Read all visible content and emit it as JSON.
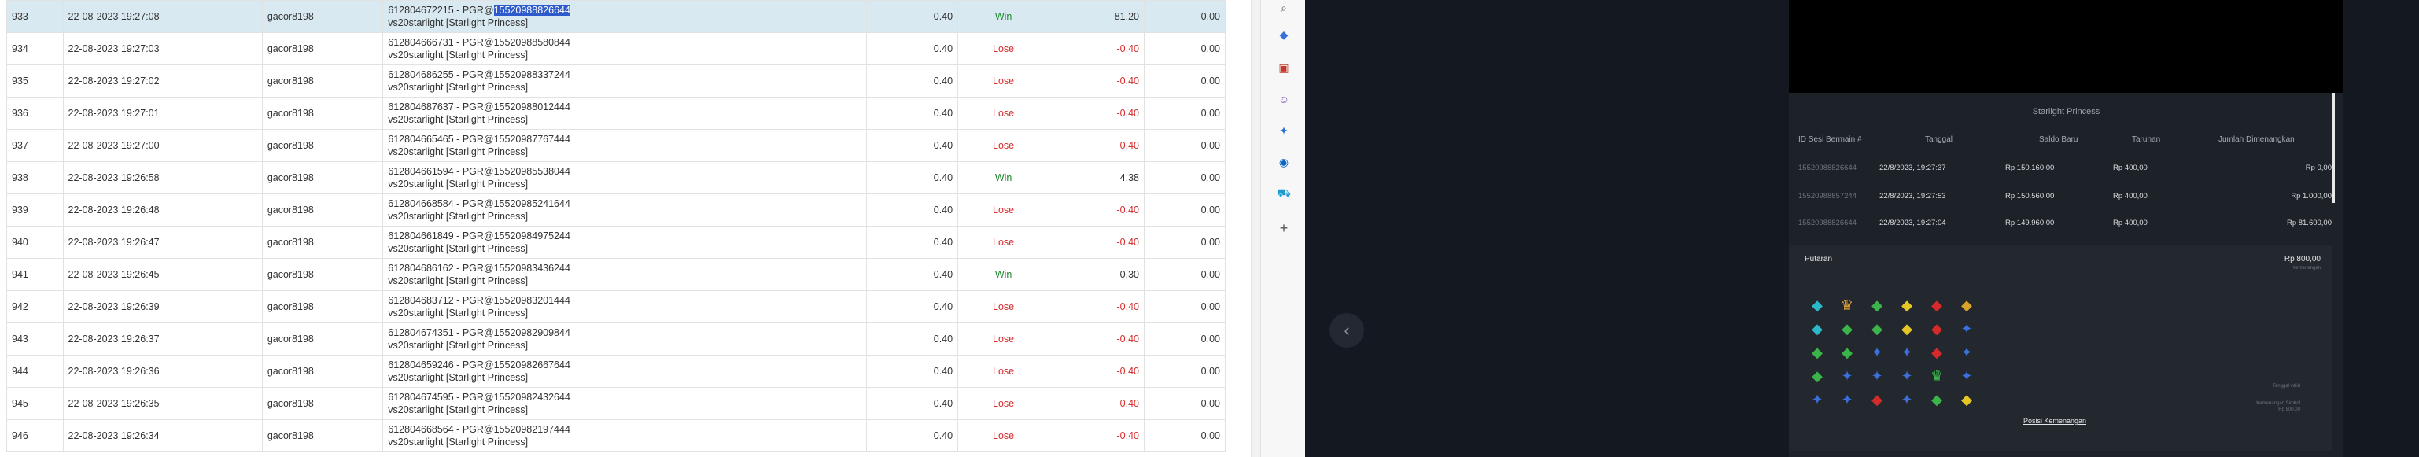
{
  "rows": [
    {
      "no": "933",
      "datetime": "22-08-2023 19:27:08",
      "user": "gacor8198",
      "desc_line1_pre": "612804672215 - PGR@",
      "desc_line1_hl": "15520988826644",
      "desc_line2": "vs20starlight [Starlight Princess]",
      "bet": "0.40",
      "result": "Win",
      "amount": "81.20",
      "extra": "0.00",
      "selected": true
    },
    {
      "no": "934",
      "datetime": "22-08-2023 19:27:03",
      "user": "gacor8198",
      "desc_line1_pre": "612804666731 - PGR@15520988580844",
      "desc_line1_hl": "",
      "desc_line2": "vs20starlight [Starlight Princess]",
      "bet": "0.40",
      "result": "Lose",
      "amount": "-0.40",
      "extra": "0.00"
    },
    {
      "no": "935",
      "datetime": "22-08-2023 19:27:02",
      "user": "gacor8198",
      "desc_line1_pre": "612804686255 - PGR@15520988337244",
      "desc_line1_hl": "",
      "desc_line2": "vs20starlight [Starlight Princess]",
      "bet": "0.40",
      "result": "Lose",
      "amount": "-0.40",
      "extra": "0.00"
    },
    {
      "no": "936",
      "datetime": "22-08-2023 19:27:01",
      "user": "gacor8198",
      "desc_line1_pre": "612804687637 - PGR@15520988012444",
      "desc_line1_hl": "",
      "desc_line2": "vs20starlight [Starlight Princess]",
      "bet": "0.40",
      "result": "Lose",
      "amount": "-0.40",
      "extra": "0.00"
    },
    {
      "no": "937",
      "datetime": "22-08-2023 19:27:00",
      "user": "gacor8198",
      "desc_line1_pre": "612804665465 - PGR@15520987767444",
      "desc_line1_hl": "",
      "desc_line2": "vs20starlight [Starlight Princess]",
      "bet": "0.40",
      "result": "Lose",
      "amount": "-0.40",
      "extra": "0.00"
    },
    {
      "no": "938",
      "datetime": "22-08-2023 19:26:58",
      "user": "gacor8198",
      "desc_line1_pre": "612804661594 - PGR@15520985538044",
      "desc_line1_hl": "",
      "desc_line2": "vs20starlight [Starlight Princess]",
      "bet": "0.40",
      "result": "Win",
      "amount": "4.38",
      "extra": "0.00"
    },
    {
      "no": "939",
      "datetime": "22-08-2023 19:26:48",
      "user": "gacor8198",
      "desc_line1_pre": "612804668584 - PGR@15520985241644",
      "desc_line1_hl": "",
      "desc_line2": "vs20starlight [Starlight Princess]",
      "bet": "0.40",
      "result": "Lose",
      "amount": "-0.40",
      "extra": "0.00"
    },
    {
      "no": "940",
      "datetime": "22-08-2023 19:26:47",
      "user": "gacor8198",
      "desc_line1_pre": "612804661849 - PGR@15520984975244",
      "desc_line1_hl": "",
      "desc_line2": "vs20starlight [Starlight Princess]",
      "bet": "0.40",
      "result": "Lose",
      "amount": "-0.40",
      "extra": "0.00"
    },
    {
      "no": "941",
      "datetime": "22-08-2023 19:26:45",
      "user": "gacor8198",
      "desc_line1_pre": "612804686162 - PGR@15520983436244",
      "desc_line1_hl": "",
      "desc_line2": "vs20starlight [Starlight Princess]",
      "bet": "0.40",
      "result": "Win",
      "amount": "0.30",
      "extra": "0.00"
    },
    {
      "no": "942",
      "datetime": "22-08-2023 19:26:39",
      "user": "gacor8198",
      "desc_line1_pre": "612804683712 - PGR@15520983201444",
      "desc_line1_hl": "",
      "desc_line2": "vs20starlight [Starlight Princess]",
      "bet": "0.40",
      "result": "Lose",
      "amount": "-0.40",
      "extra": "0.00"
    },
    {
      "no": "943",
      "datetime": "22-08-2023 19:26:37",
      "user": "gacor8198",
      "desc_line1_pre": "612804674351 - PGR@15520982909844",
      "desc_line1_hl": "",
      "desc_line2": "vs20starlight [Starlight Princess]",
      "bet": "0.40",
      "result": "Lose",
      "amount": "-0.40",
      "extra": "0.00"
    },
    {
      "no": "944",
      "datetime": "22-08-2023 19:26:36",
      "user": "gacor8198",
      "desc_line1_pre": "612804659246 - PGR@15520982667644",
      "desc_line1_hl": "",
      "desc_line2": "vs20starlight [Starlight Princess]",
      "bet": "0.40",
      "result": "Lose",
      "amount": "-0.40",
      "extra": "0.00"
    },
    {
      "no": "945",
      "datetime": "22-08-2023 19:26:35",
      "user": "gacor8198",
      "desc_line1_pre": "612804674595 - PGR@15520982432644",
      "desc_line1_hl": "",
      "desc_line2": "vs20starlight [Starlight Princess]",
      "bet": "0.40",
      "result": "Lose",
      "amount": "-0.40",
      "extra": "0.00"
    },
    {
      "no": "946",
      "datetime": "22-08-2023 19:26:34",
      "user": "gacor8198",
      "desc_line1_pre": "612804668564 - PGR@15520982197444",
      "desc_line1_hl": "",
      "desc_line2": "vs20starlight [Starlight Princess]",
      "bet": "0.40",
      "result": "Lose",
      "amount": "-0.40",
      "extra": "0.00"
    }
  ],
  "colors": {
    "win": "#1e8b2e",
    "lose": "#d62b2b",
    "selected_row": "#d9e9f1",
    "highlight": "#2e5bcc"
  },
  "sidebar_icons": [
    "search-icon",
    "tag-icon",
    "toolbox-icon",
    "people-icon",
    "extension-icon",
    "outlook-icon",
    "cart-icon",
    "plus-icon"
  ],
  "game": {
    "title": "Starlight Princess",
    "headers": {
      "id": "ID Sesi Bermain #",
      "date": "Tanggal",
      "balance": "Saldo Baru",
      "bet": "Taruhan",
      "win": "Jumlah Dimenangkan"
    },
    "rows": [
      {
        "id": "15520988826644",
        "date": "22/8/2023, 19:27:37",
        "balance": "Rp 150.160,00",
        "bet": "Rp 400,00",
        "win": "Rp 0,00"
      },
      {
        "id": "15520988857244",
        "date": "22/8/2023, 19:27:53",
        "balance": "Rp 150.560,00",
        "bet": "Rp 400,00",
        "win": "Rp 1.000,00"
      },
      {
        "id": "15520988826644",
        "date": "22/8/2023, 19:27:04",
        "balance": "Rp 149.960,00",
        "bet": "Rp 400,00",
        "win": "Rp 81.600,00"
      }
    ],
    "putaran_label": "Putaran",
    "putaran_amount": "Rp 800,00",
    "putaran_sub": "kemenangan",
    "pola_link": "Posisi Kemenangan",
    "tiny_1": "Tanggal valid",
    "tiny_2": "Kemenangan Simbol",
    "tiny_3": "Rp 800,00",
    "back_icon": "chevron-left-icon"
  }
}
